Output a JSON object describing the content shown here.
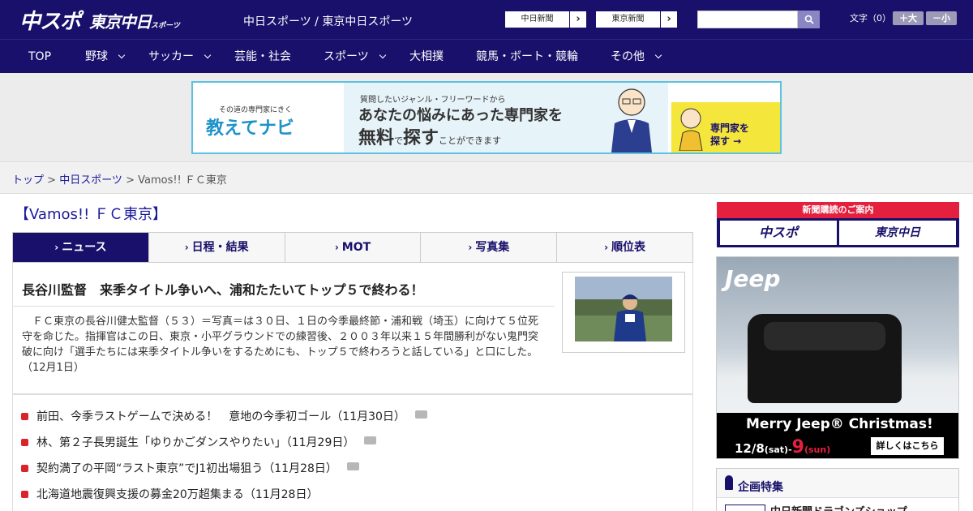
{
  "header": {
    "logo_main": "中スポ",
    "logo_sub": "東京中日",
    "logo_sub_small": "スポーツ",
    "site_title": "中日スポーツ / 東京中日スポーツ",
    "paper_links": [
      {
        "label": "中日新聞",
        "arrow": "›"
      },
      {
        "label": "東京新聞",
        "arrow": "›"
      }
    ],
    "search_placeholder": "",
    "font_label": "文字（0）",
    "font_up": "＋大",
    "font_down": "－小"
  },
  "nav": {
    "items": [
      {
        "label": "TOP",
        "dropdown": false
      },
      {
        "label": "野球",
        "dropdown": true
      },
      {
        "label": "サッカー",
        "dropdown": true
      },
      {
        "label": "芸能・社会",
        "dropdown": false
      },
      {
        "label": "スポーツ",
        "dropdown": true
      },
      {
        "label": "大相撲",
        "dropdown": false
      },
      {
        "label": "競馬・ボート・競輪",
        "dropdown": false
      },
      {
        "label": "その他",
        "dropdown": true
      }
    ]
  },
  "banner": {
    "sub": "その道の専門家にきく",
    "brand": "教えてナビ",
    "line1": "質問したいジャンル・フリーワードから",
    "line2": "あなたの悩みにあった専門家を",
    "line3a": "無料",
    "line3b": "で",
    "line3c": "探す",
    "line3d": "ことができます",
    "cta_line1": "専門家を",
    "cta_line2": "探す →"
  },
  "breadcrumb": {
    "top": "トップ",
    "sep": " > ",
    "section": "中日スポーツ",
    "current": "Vamos!! ＦＣ東京"
  },
  "page": {
    "title": "【Vamos!! ＦＣ東京】",
    "tabs": [
      {
        "label": "ニュース",
        "active": true
      },
      {
        "label": "日程・結果",
        "active": false
      },
      {
        "label": "MOT",
        "active": false
      },
      {
        "label": "写真集",
        "active": false
      },
      {
        "label": "順位表",
        "active": false
      }
    ],
    "tab_chevron": "›"
  },
  "article": {
    "headline": "長谷川監督　来季タイトル争いへ、浦和たたいてトップ５で終わる！",
    "body": "ＦＣ東京の長谷川健太監督（５３）＝写真＝は３０日、１日の今季最終節・浦和戦（埼玉）に向けて５位死守を命じた。指揮官はこの日、東京・小平グラウンドでの練習後、２００３年以来１５年間勝利がない鬼門突破に向け「選手たちには来季タイトル争いをするためにも、トップ５で終わろうと話している」と口にした。（12月1日）"
  },
  "news_list": [
    {
      "text": "前田、今季ラストゲームで決める！　意地の今季初ゴール（11月30日）",
      "photo": true
    },
    {
      "text": "林、第２子長男誕生「ゆりかごダンスやりたい」（11月29日）",
      "photo": true
    },
    {
      "text": "契約満了の平岡“ラスト東京”でJ1初出場狙う（11月28日）",
      "photo": true
    },
    {
      "text": "北海道地震復興支援の募金20万超集まる（11月28日）",
      "photo": false
    }
  ],
  "sidebar": {
    "subscribe_head": "新聞購読のご案内",
    "subscribe_btn1": "中スポ",
    "subscribe_btn2": "東京中日",
    "jeep_logo": "Jeep",
    "jeep_line1": "Merry Jeep® Christmas!",
    "jeep_date_a": "12/8",
    "jeep_date_b": "(sat)-",
    "jeep_date_c": "9",
    "jeep_date_d": "(sun)",
    "jeep_cta": "詳しくはこちら",
    "feature_title": "企画特集",
    "feature_item": "中日新聞ドラゴンズショップ"
  },
  "colors": {
    "navy": "#18106b",
    "accent_red": "#d9242a",
    "banner_blue": "#5bc2e0"
  }
}
